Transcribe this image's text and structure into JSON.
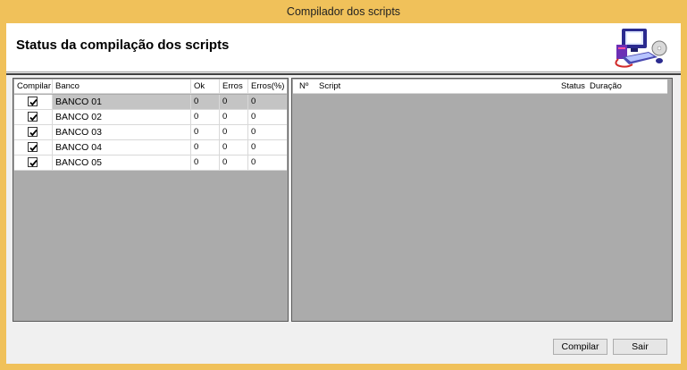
{
  "window": {
    "title": "Compilador dos scripts"
  },
  "header": {
    "title": "Status da compilação dos scripts",
    "icon": "computer-icon"
  },
  "left_grid": {
    "columns": [
      "Compilar",
      "Banco",
      "Ok",
      "Erros",
      "Erros(%)"
    ],
    "rows": [
      {
        "compilar": true,
        "banco": "BANCO 01",
        "ok": "0",
        "erros": "0",
        "erros_pct": "0"
      },
      {
        "compilar": true,
        "banco": "BANCO 02",
        "ok": "0",
        "erros": "0",
        "erros_pct": "0"
      },
      {
        "compilar": true,
        "banco": "BANCO 03",
        "ok": "0",
        "erros": "0",
        "erros_pct": "0"
      },
      {
        "compilar": true,
        "banco": "BANCO 04",
        "ok": "0",
        "erros": "0",
        "erros_pct": "0"
      },
      {
        "compilar": true,
        "banco": "BANCO 05",
        "ok": "0",
        "erros": "0",
        "erros_pct": "0"
      }
    ]
  },
  "right_grid": {
    "columns": [
      "Nº",
      "Script",
      "Status",
      "Duração"
    ],
    "rows": []
  },
  "buttons": {
    "compilar": "Compilar",
    "sair": "Sair"
  },
  "colors": {
    "titlebar": "#f0c15a",
    "grid_background": "#ababab",
    "selected_row": "#c4c4c4"
  }
}
